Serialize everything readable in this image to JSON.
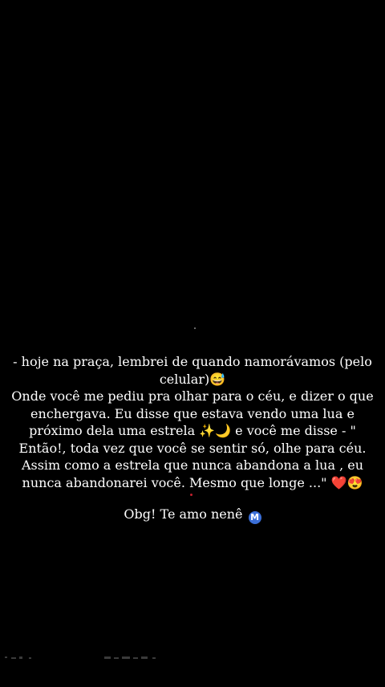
{
  "caption": {
    "lines": [
      "- hoje na praça, lembrei de  quando namorávamos (pelo",
      "celular)😅",
      "Onde você me pediu pra olhar para o céu, e dizer o que",
      "enchergava. Eu disse que estava vendo uma lua e",
      "próximo dela uma estrela ✨🌙 e você me disse - \"",
      "Então!, toda vez que você se sentir só, olhe para céu.",
      "Assim como a estrela que nunca abandona a lua , eu",
      "nunca abandonarei você. Mesmo que longe ...\" ❤️😍"
    ],
    "signoff": "Obg! Te amo nenê",
    "signoff_badge": "M"
  },
  "colors": {
    "background": "#000000",
    "text": "#ffffff",
    "badge": "#3b6fd8"
  }
}
